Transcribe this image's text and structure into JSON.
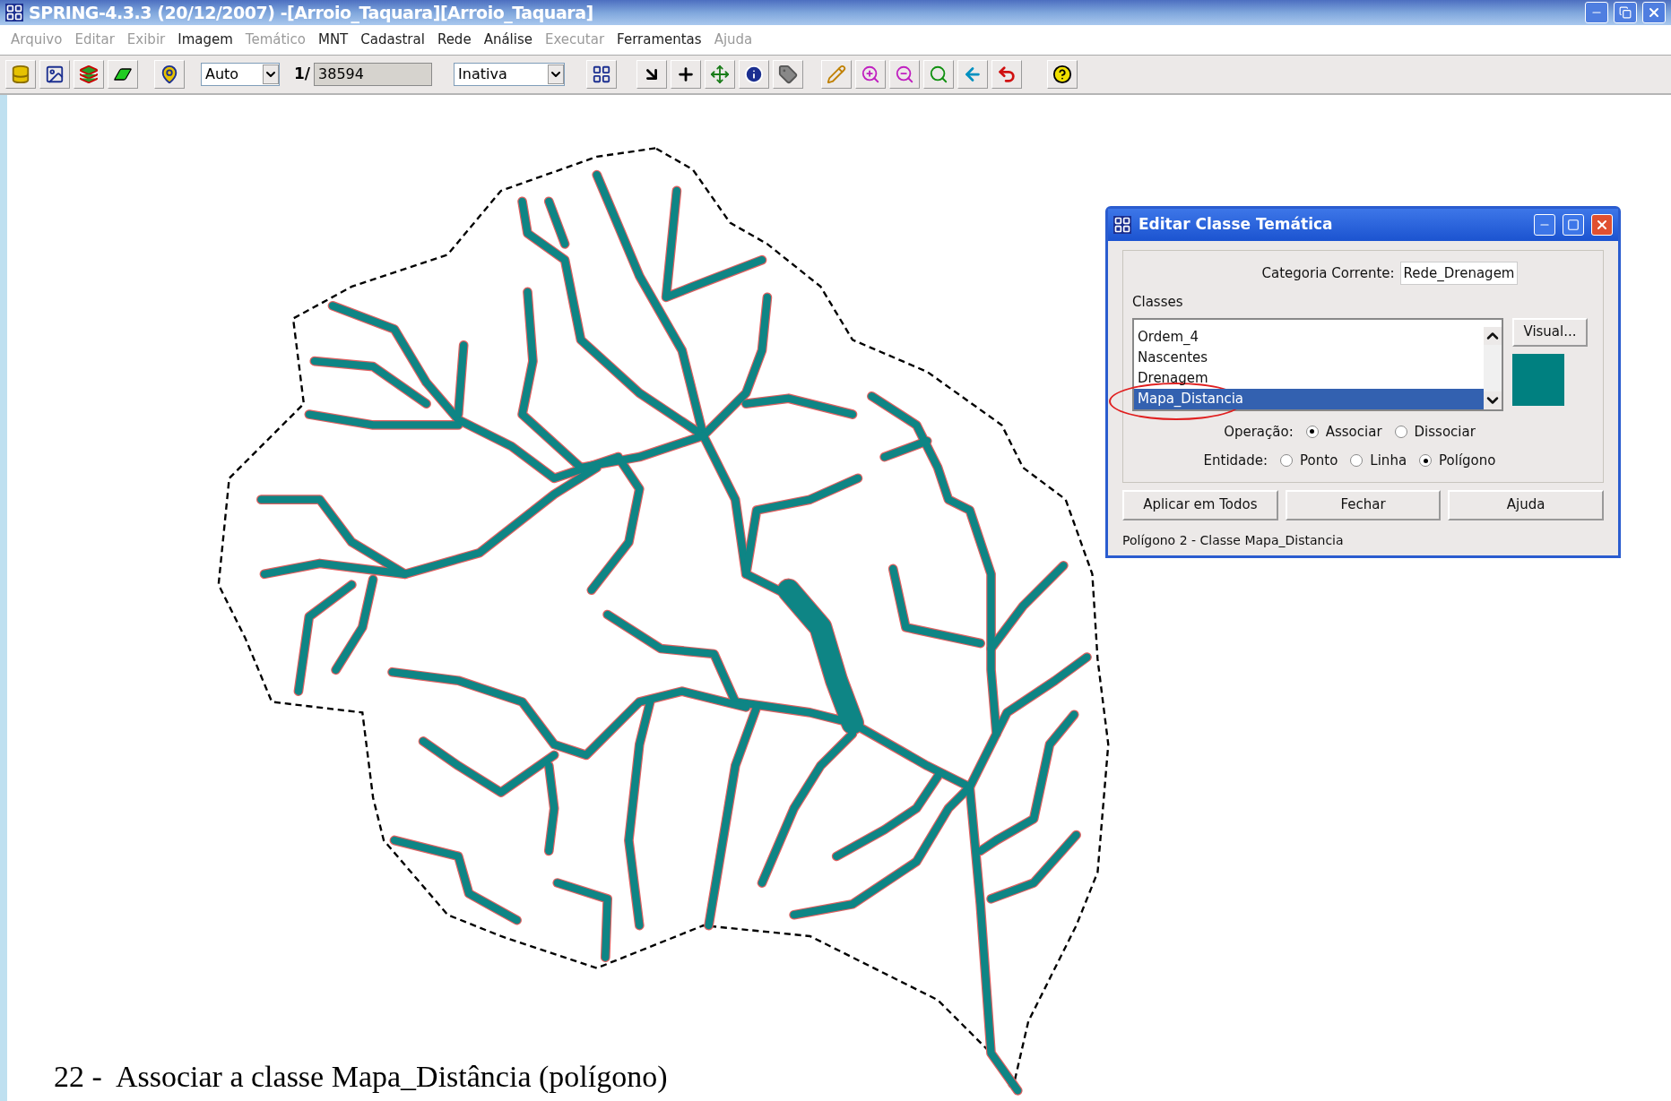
{
  "window": {
    "title": "SPRING-4.3.3 (20/12/2007) -[Arroio_Taquara][Arroio_Taquara]"
  },
  "menu": [
    {
      "label": "Arquivo",
      "disabled": true
    },
    {
      "label": "Editar",
      "disabled": true
    },
    {
      "label": "Exibir",
      "disabled": true
    },
    {
      "label": "Imagem",
      "disabled": false
    },
    {
      "label": "Temático",
      "disabled": true
    },
    {
      "label": "MNT",
      "disabled": false
    },
    {
      "label": "Cadastral",
      "disabled": false
    },
    {
      "label": "Rede",
      "disabled": false
    },
    {
      "label": "Análise",
      "disabled": false
    },
    {
      "label": "Executar",
      "disabled": true
    },
    {
      "label": "Ferramentas",
      "disabled": false
    },
    {
      "label": "Ajuda",
      "disabled": true
    }
  ],
  "toolbar": {
    "zoom_mode": "Auto",
    "scale_prefix": "1/",
    "scale": "38594",
    "edit_mode": "Inativa"
  },
  "dialog": {
    "title": "Editar Classe Temática",
    "category_label": "Categoria Corrente:",
    "category": "Rede_Drenagem",
    "classes_label": "Classes",
    "classes": [
      {
        "label": "Ordem_4",
        "selected": false
      },
      {
        "label": "Nascentes",
        "selected": false
      },
      {
        "label": "Drenagem",
        "selected": false
      },
      {
        "label": "Mapa_Distancia",
        "selected": true
      }
    ],
    "visual_button": "Visual...",
    "color": "#008080",
    "operation": {
      "label": "Operação:",
      "options": [
        {
          "label": "Associar",
          "selected": true
        },
        {
          "label": "Dissociar",
          "selected": false
        }
      ]
    },
    "entity": {
      "label": "Entidade:",
      "options": [
        {
          "label": "Ponto",
          "selected": false
        },
        {
          "label": "Linha",
          "selected": false
        },
        {
          "label": "Polígono",
          "selected": true
        }
      ]
    },
    "buttons": [
      "Aplicar em Todos",
      "Fechar",
      "Ajuda"
    ],
    "status": "Polígono 2 - Classe Mapa_Distancia"
  },
  "caption": "22 -  Associar a classe Mapa_Distância (polígono)"
}
